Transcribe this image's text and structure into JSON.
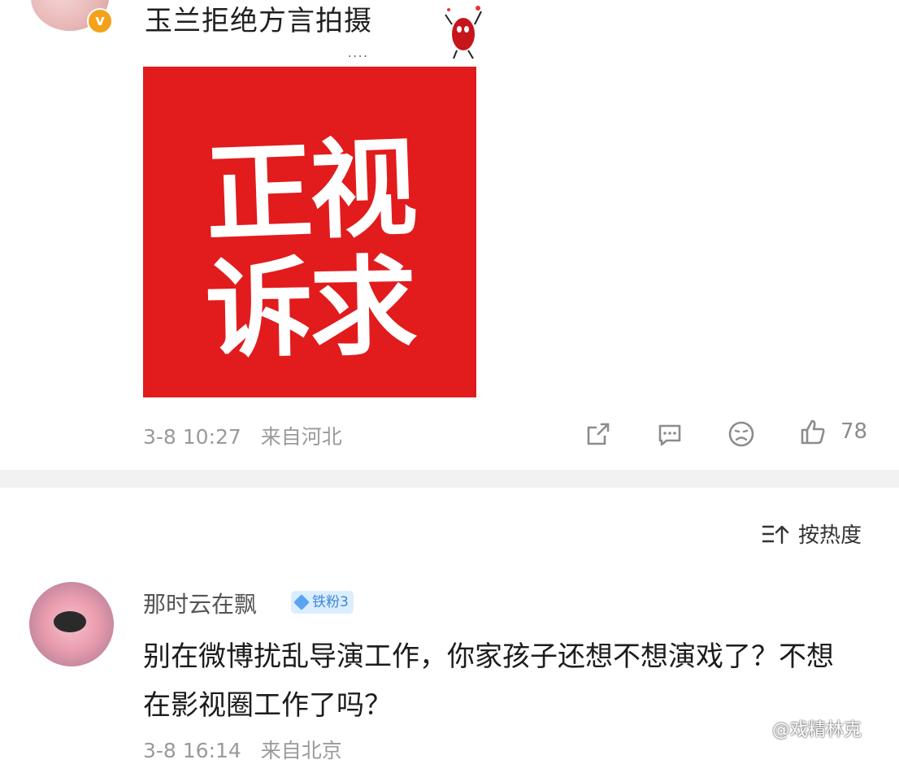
{
  "post": {
    "text": "玉兰拒绝方言拍摄",
    "poster_line1": "正视",
    "poster_line2": "诉求",
    "timestamp": "3-8 10:27",
    "source": "来自河北",
    "like_count": "78",
    "dots": "...."
  },
  "sort": {
    "label": "按热度"
  },
  "comment": {
    "username": "那时云在飘",
    "fan_badge": "铁粉3",
    "text": "别在微博扰乱导演工作，你家孩子还想不想演戏了？不想在影视圈工作了吗？",
    "timestamp": "3-8 16:14",
    "source": "来自北京"
  },
  "watermark": "@戏精林克",
  "colors": {
    "poster_red": "#e21b1d",
    "badge_orange": "#f4a11c",
    "fan_blue": "#3e86d8"
  },
  "icons": [
    "share-icon",
    "comment-icon",
    "dislike-icon",
    "like-icon",
    "sort-icon",
    "weibo-logo-icon"
  ]
}
